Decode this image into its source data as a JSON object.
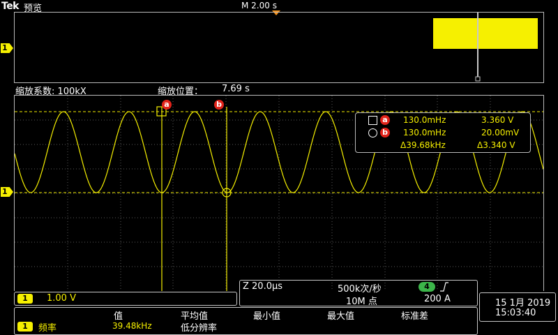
{
  "header": {
    "logo": "Tek",
    "mode": "预览",
    "timebase": "M 2.00 s"
  },
  "overview": {
    "channel": "1"
  },
  "zoom": {
    "factor_label": "缩放系数: 100kX",
    "position_label": "缩放位置：",
    "position_value": "7.69 s",
    "channel": "1",
    "cursor_a_label": "a",
    "cursor_b_label": "b"
  },
  "cursor_readout": {
    "a_label": "a",
    "a_freq": "130.0mHz",
    "a_volt": "3.360 V",
    "b_label": "b",
    "b_freq": "130.0mHz",
    "b_volt": "20.00mV",
    "delta_freq": "Δ39.68kHz",
    "delta_volt": "Δ3.340 V"
  },
  "channel_panel": {
    "ch": "1",
    "scale": "1.00 V"
  },
  "horizontal": {
    "zoom_scale": "Z 20.0µs",
    "sample_rate": "500k次/秒",
    "record_length": "10M 点",
    "trigger_ch": "4",
    "trigger_slope": "⎍",
    "trigger_level": "200 A"
  },
  "datetime": {
    "date": "15 1月 2019",
    "time": "15:03:40"
  },
  "measurement": {
    "headers": [
      "值",
      "平均值",
      "最小值",
      "最大值",
      "标准差"
    ],
    "ch": "1",
    "name": "频率",
    "value": "39.48kHz",
    "note": "低分辨率"
  },
  "colors": {
    "trace": "#f6f000",
    "trigger_marker": "#f7941d",
    "cursor_badge": "#e2231a",
    "trigger_badge": "#3cb54a"
  }
}
